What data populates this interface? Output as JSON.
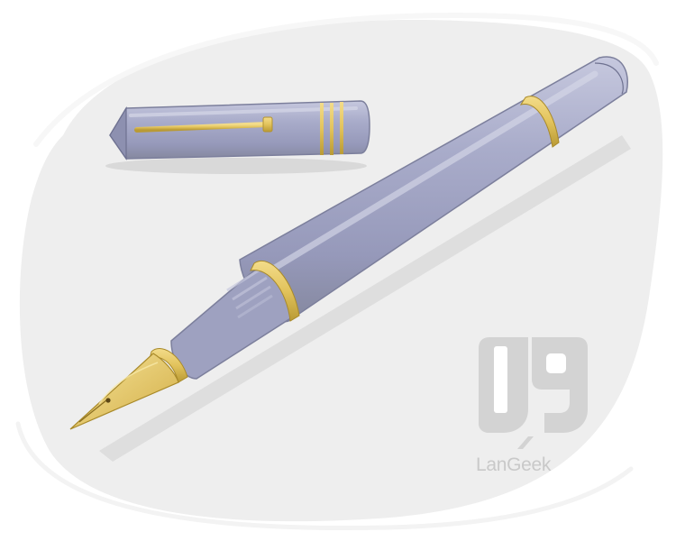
{
  "image": {
    "subject": "fountain-pen-with-cap",
    "colors": {
      "backdrop": "#eeeeee",
      "barrel": "#a4a7c7",
      "barrel_shadow": "#8a8dae",
      "barrel_highlight": "#c6c8de",
      "gold": "#e2c35c",
      "gold_dark": "#b4932e",
      "logo": "#d3d3d3"
    }
  },
  "watermark": {
    "brand": "LanGeek"
  }
}
